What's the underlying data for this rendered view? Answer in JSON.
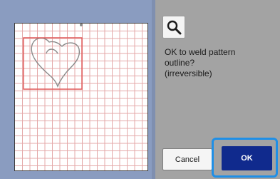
{
  "dialog": {
    "message": "OK to weld pattern\noutline?\n(irreversible)",
    "cancel_label": "Cancel",
    "ok_label": "OK"
  },
  "icons": {
    "zoom": "magnifier-icon"
  },
  "colors": {
    "left_panel_bg": "#8a9cc0",
    "right_panel_bg": "#a3a3a3",
    "ok_button_bg": "#102a8d",
    "focus_frame": "#1f8fe6",
    "selection_box": "#e05a5a",
    "grid_line": "#e4a9a9"
  }
}
